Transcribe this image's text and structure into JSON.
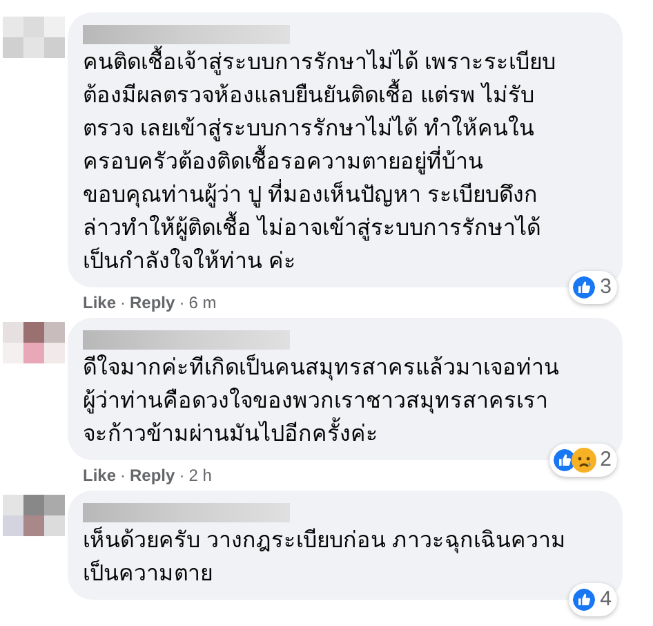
{
  "comments": [
    {
      "text": "คนติดเชื้อเจ้าสู่ระบบการรักษาไม่ได้ เพราะระเบียบ\nต้องมีผลตรวจห้องแลบยืนยันติดเชื้อ แต่รพ ไม่รับ\nตรวจ เลยเข้าสู่ระบบการรักษาไม่ได้ ทำให้คนใน\nครอบครัวต้องติดเชื้อรอความตายอยู่ที่บ้าน\nขอบคุณท่านผู้ว่า ปู ที่มองเห็นปัญหา ระเบียบดึงก\nล่าวทำให้ผู้ติดเชื้อ ไม่อาจเข้าสู่ระบบการรักษาได้\nเป็นกำลังใจให้ท่าน ค่ะ",
      "like": "Like",
      "separator_1": "·",
      "reply": "Reply",
      "separator_2": "·",
      "time": "6 m",
      "reactions": [
        {
          "kind": "like"
        }
      ],
      "reaction_count": "3"
    },
    {
      "text": "ดีใจมากค่ะทีเกิดเป็นคนสมุทรสาครแล้วมาเจอท่าน\nผู้ว่าท่านคือดวงใจของพวกเราชาวสมุทรสาครเรา\nจะก้าวข้ามผ่านมันไปอีกครั้งค่ะ",
      "like": "Like",
      "separator_1": "·",
      "reply": "Reply",
      "separator_2": "·",
      "time": "2 h",
      "reactions": [
        {
          "kind": "like"
        },
        {
          "kind": "sad"
        }
      ],
      "reaction_count": "2"
    },
    {
      "text": "เห็นด้วยครับ วางกฎระเบียบก่อน ภาวะฉุกเฉินความ\nเป็นความตาย",
      "reactions": [
        {
          "kind": "like"
        }
      ],
      "reaction_count": "4"
    }
  ]
}
